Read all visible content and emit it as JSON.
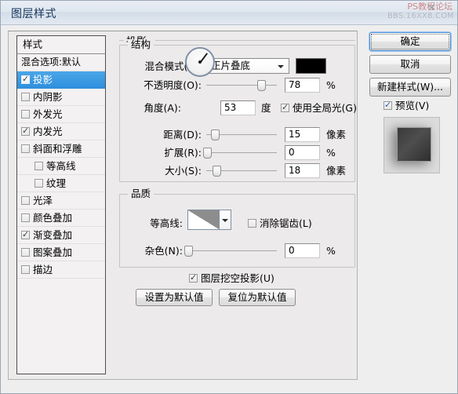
{
  "window": {
    "title": "图层样式"
  },
  "watermark": {
    "line1": "PS教程论坛",
    "line2": "BBS.16XX8.COM",
    "close_glyph": "✕"
  },
  "styles_panel": {
    "header": "样式",
    "blend_option": "混合选项:默认",
    "items": [
      {
        "label": "投影",
        "checked": true,
        "selected": true,
        "indent": false
      },
      {
        "label": "内阴影",
        "checked": false,
        "selected": false,
        "indent": false
      },
      {
        "label": "外发光",
        "checked": false,
        "selected": false,
        "indent": false
      },
      {
        "label": "内发光",
        "checked": true,
        "selected": false,
        "indent": false
      },
      {
        "label": "斜面和浮雕",
        "checked": false,
        "selected": false,
        "indent": false
      },
      {
        "label": "等高线",
        "checked": false,
        "selected": false,
        "indent": true
      },
      {
        "label": "纹理",
        "checked": false,
        "selected": false,
        "indent": true
      },
      {
        "label": "光泽",
        "checked": false,
        "selected": false,
        "indent": false
      },
      {
        "label": "颜色叠加",
        "checked": false,
        "selected": false,
        "indent": false
      },
      {
        "label": "渐变叠加",
        "checked": true,
        "selected": false,
        "indent": false
      },
      {
        "label": "图案叠加",
        "checked": false,
        "selected": false,
        "indent": false
      },
      {
        "label": "描边",
        "checked": false,
        "selected": false,
        "indent": false
      }
    ]
  },
  "shadow_panel": {
    "title": "投影",
    "structure": {
      "title": "结构",
      "blend_mode_label": "混合模式(B):",
      "blend_mode_value": "正片叠底",
      "color_swatch": "#000000",
      "opacity_label": "不透明度(O):",
      "opacity_value": "78",
      "opacity_unit": "%",
      "angle_label": "角度(A):",
      "angle_value": "53",
      "angle_unit": "度",
      "global_light_label": "使用全局光(G)",
      "global_light_checked": true,
      "distance_label": "距离(D):",
      "distance_value": "15",
      "distance_unit": "像素",
      "spread_label": "扩展(R):",
      "spread_value": "0",
      "spread_unit": "%",
      "size_label": "大小(S):",
      "size_value": "18",
      "size_unit": "像素"
    },
    "quality": {
      "title": "品质",
      "contour_label": "等高线:",
      "antialias_label": "消除锯齿(L)",
      "antialias_checked": false,
      "noise_label": "杂色(N):",
      "noise_value": "0",
      "noise_unit": "%"
    },
    "knockout_label": "图层挖空投影(U)",
    "knockout_checked": true,
    "make_default_label": "设置为默认值",
    "reset_default_label": "复位为默认值"
  },
  "right_buttons": {
    "ok": "确定",
    "cancel": "取消",
    "new_style": "新建样式(W)...",
    "preview_label": "预览(V)",
    "preview_checked": true
  },
  "colors": {
    "selection_blue": "#2f8fdd",
    "title_text": "#14355c",
    "panel_bg": "#eceaea"
  }
}
